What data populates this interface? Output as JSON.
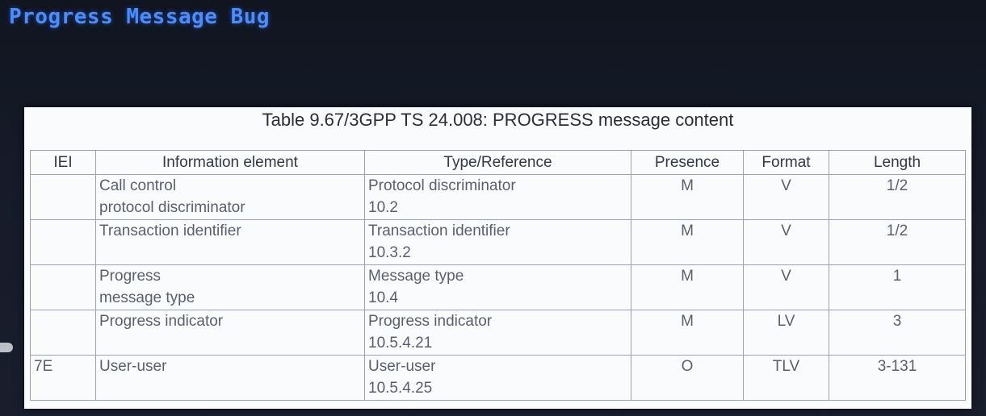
{
  "slide": {
    "title": "Progress Message Bug"
  },
  "table": {
    "caption": "Table 9.67/3GPP TS 24.008: PROGRESS message content",
    "headers": [
      "IEI",
      "Information element",
      "Type/Reference",
      "Presence",
      "Format",
      "Length"
    ],
    "rows": [
      {
        "iei": "",
        "element": [
          "Call control",
          "protocol discriminator"
        ],
        "type": [
          "Protocol discriminator",
          "10.2"
        ],
        "presence": "M",
        "format": "V",
        "length": "1/2"
      },
      {
        "iei": "",
        "element": [
          "Transaction identifier"
        ],
        "type": [
          "Transaction identifier",
          "10.3.2"
        ],
        "presence": "M",
        "format": "V",
        "length": "1/2"
      },
      {
        "iei": "",
        "element": [
          "Progress",
          "message type"
        ],
        "type": [
          "Message type",
          "10.4"
        ],
        "presence": "M",
        "format": "V",
        "length": "1"
      },
      {
        "iei": "",
        "element": [
          "Progress indicator"
        ],
        "type": [
          "Progress indicator",
          "10.5.4.21"
        ],
        "presence": "M",
        "format": "LV",
        "length": "3"
      },
      {
        "iei": "7E",
        "element": [
          "User-user"
        ],
        "type": [
          "User-user",
          "10.5.4.25"
        ],
        "presence": "O",
        "format": "TLV",
        "length": "3-131"
      }
    ]
  },
  "colors": {
    "title": "#4a8dff",
    "background": "#151b28",
    "panel": "#fafbfd",
    "grid": "#9aa0b8"
  }
}
